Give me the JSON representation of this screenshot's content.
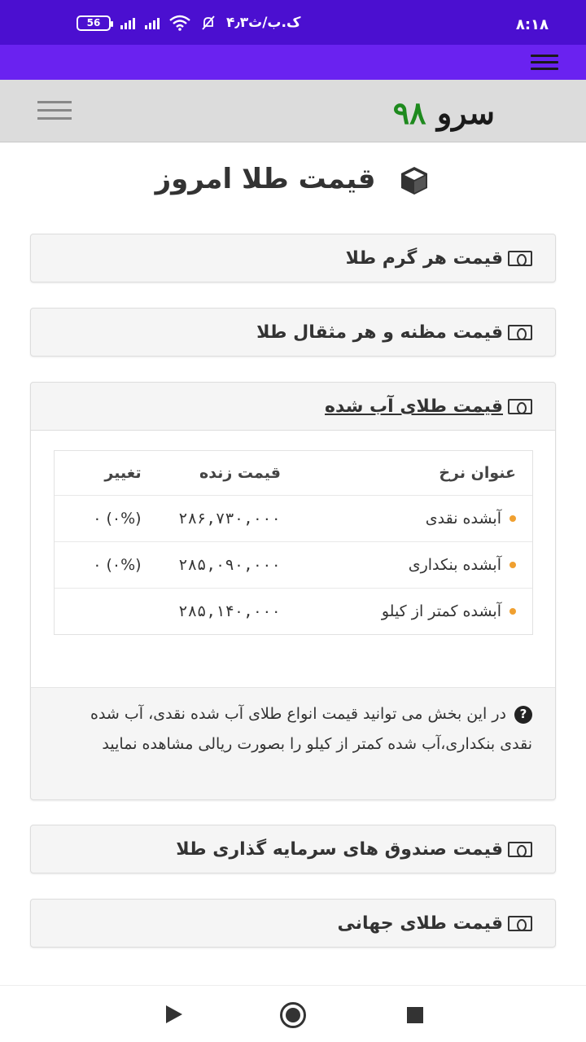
{
  "status_bar": {
    "time": "۸:۱۸",
    "battery": "56",
    "speed": "۴٫۳ک.ب/ث"
  },
  "header": {
    "logo_text": "سرو",
    "logo_number": "۹۸"
  },
  "page_title": "قیمت طلا امروز",
  "panels": [
    {
      "title": "قیمت هر گرم طلا"
    },
    {
      "title": "قیمت مظنه و هر مثقال طلا"
    },
    {
      "title": "قیمت طلای آب شده"
    },
    {
      "title": "قیمت صندوق های سرمایه گذاری طلا"
    },
    {
      "title": "قیمت طلای جهانی"
    }
  ],
  "rate_table": {
    "headers": {
      "title": "عنوان نرخ",
      "price": "قیمت زنده",
      "change": "تغییر"
    },
    "rows": [
      {
        "title": "آبشده نقدی",
        "price": "۲۸۶,۷۳۰,۰۰۰",
        "change": "(۰%) ۰"
      },
      {
        "title": "آبشده بنکداری",
        "price": "۲۸۵,۰۹۰,۰۰۰",
        "change": "(۰%) ۰"
      },
      {
        "title": "آبشده کمتر از کیلو",
        "price": "۲۸۵,۱۴۰,۰۰۰",
        "change": ""
      }
    ]
  },
  "info_text": "در این بخش می توانید قیمت انواع طلای آب شده نقدی، آب شده نقدی بنکداری،آب شده کمتر از کیلو را بصورت ریالی مشاهده نمایید",
  "colors": {
    "status_bar": "#4b0fd0",
    "app_bar": "#6a22f0",
    "logo_number": "#1e8a1e",
    "bullet": "#f0a030"
  }
}
